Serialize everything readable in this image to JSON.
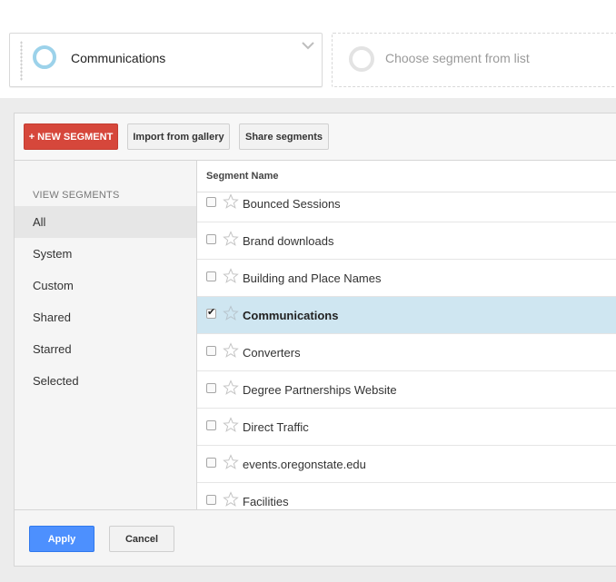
{
  "segments_bar": {
    "active": {
      "label": "Communications"
    },
    "placeholder": {
      "label": "Choose segment from list"
    }
  },
  "toolbar": {
    "new_segment_label": "+ NEW SEGMENT",
    "import_label": "Import from gallery",
    "share_label": "Share segments"
  },
  "sidebar": {
    "heading": "VIEW SEGMENTS",
    "items": [
      {
        "label": "All",
        "selected": true
      },
      {
        "label": "System"
      },
      {
        "label": "Custom"
      },
      {
        "label": "Shared"
      },
      {
        "label": "Starred"
      },
      {
        "label": "Selected"
      }
    ]
  },
  "list": {
    "header": "Segment Name",
    "rows": [
      {
        "label": "",
        "checked": false
      },
      {
        "label": "Bounced Sessions",
        "checked": false
      },
      {
        "label": "Brand downloads",
        "checked": false
      },
      {
        "label": "Building and Place Names",
        "checked": false
      },
      {
        "label": "Communications",
        "checked": true
      },
      {
        "label": "Converters",
        "checked": false
      },
      {
        "label": "Degree Partnerships Website",
        "checked": false
      },
      {
        "label": "Direct Traffic",
        "checked": false
      },
      {
        "label": "events.oregonstate.edu",
        "checked": false
      },
      {
        "label": "Facilities",
        "checked": false
      }
    ]
  },
  "footer": {
    "apply_label": "Apply",
    "cancel_label": "Cancel"
  },
  "colors": {
    "accent_red": "#d6473b",
    "accent_blue": "#4d90fe",
    "selected_row": "#cfe6f1",
    "ring_blue": "#9cd2ea"
  },
  "icons": {
    "drag_handle": "drag-handle-icon",
    "segment_ring": "segment-ring-icon",
    "chevron": "chevron-down-icon",
    "star": "star-outline-icon",
    "checkbox": "checkbox-icon"
  }
}
